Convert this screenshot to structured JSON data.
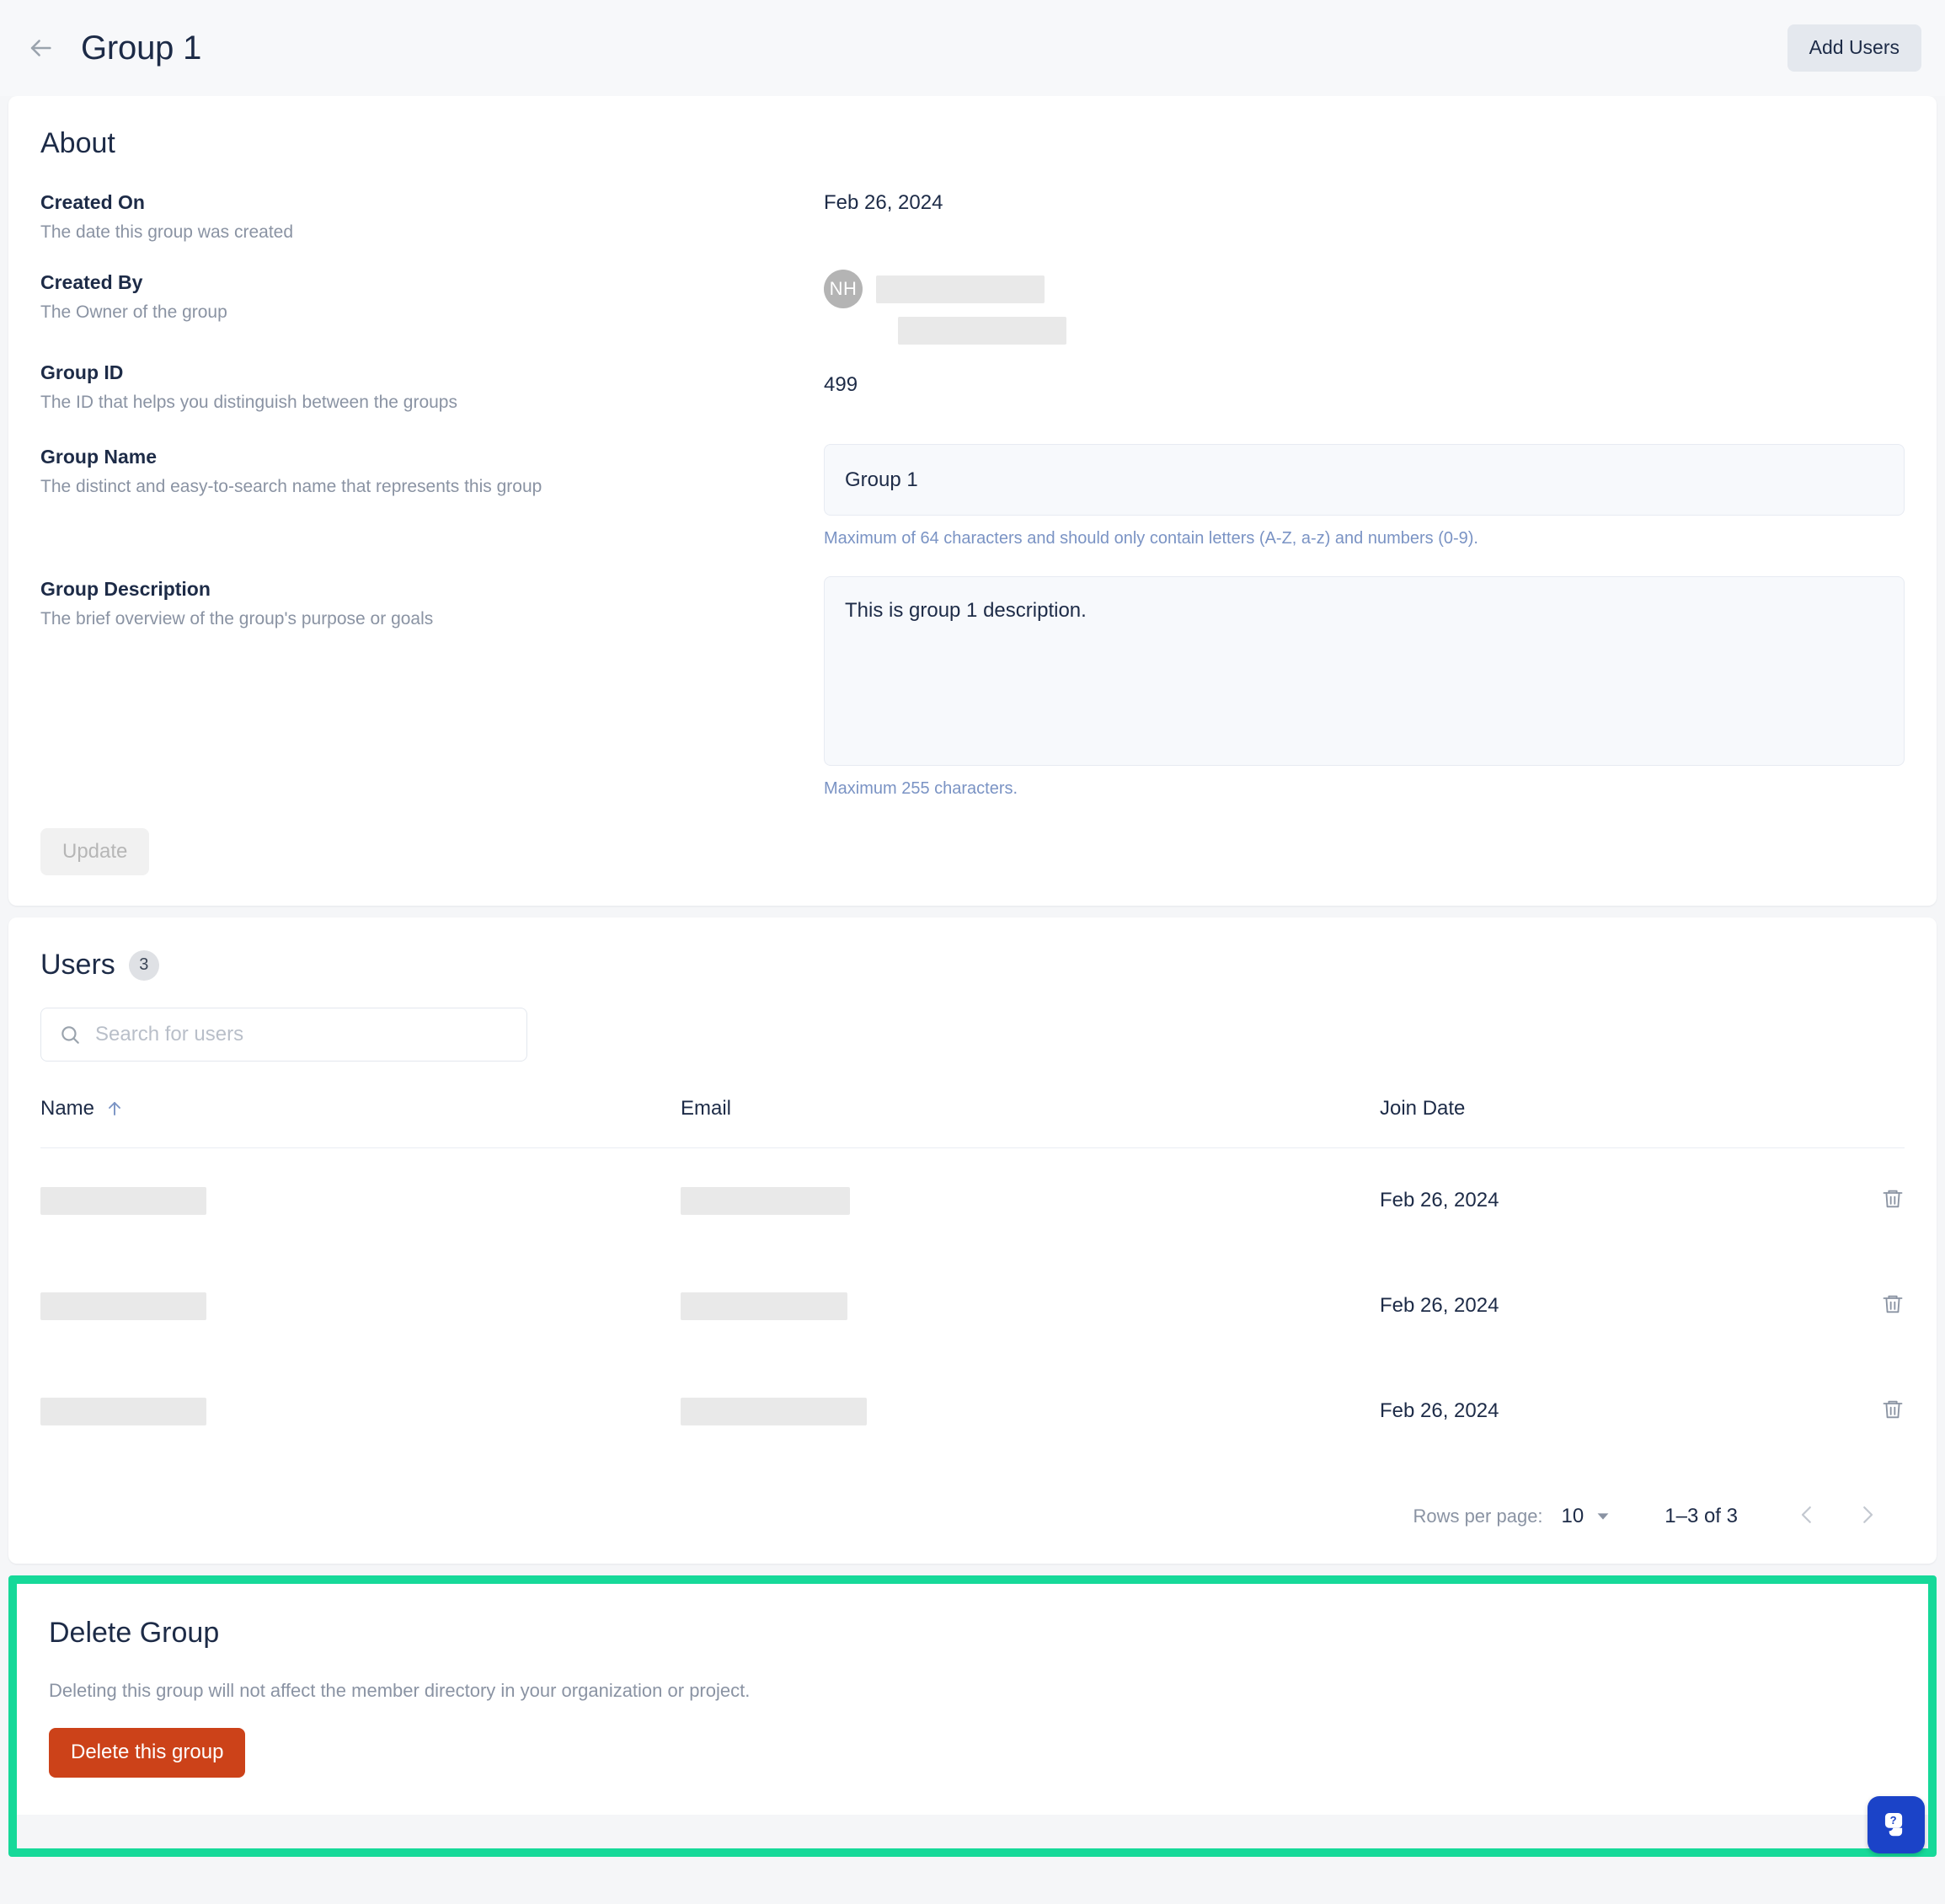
{
  "header": {
    "back_icon": "arrow-left-icon",
    "title": "Group 1",
    "add_users_label": "Add Users"
  },
  "about": {
    "section_title": "About",
    "fields": [
      {
        "label": "Created On",
        "description": "The date this group was created",
        "value": "Feb 26, 2024"
      },
      {
        "label": "Created By",
        "description": "The Owner of the group",
        "avatar_initials": "NH",
        "value_redacted": true
      },
      {
        "label": "Group ID",
        "description": "The ID that helps you distinguish between the groups",
        "value": "499"
      },
      {
        "label": "Group Name",
        "description": "The distinct and easy-to-search name that represents this group",
        "value": "Group 1",
        "helper": "Maximum of 64 characters and should only contain letters (A-Z, a-z) and numbers (0-9)."
      },
      {
        "label": "Group Description",
        "description": "The brief overview of the group's purpose or goals",
        "value": "This is group 1 description.",
        "helper": "Maximum 255 characters."
      }
    ],
    "update_label": "Update"
  },
  "users": {
    "section_title": "Users",
    "count": "3",
    "search_placeholder": "Search for users",
    "search_value": "",
    "search_icon": "search-icon",
    "columns": {
      "name": "Name",
      "email": "Email",
      "join_date": "Join Date"
    },
    "sort": {
      "column": "Name",
      "direction": "asc",
      "icon": "arrow-up-icon"
    },
    "rows": [
      {
        "name": "",
        "email": "",
        "join_date": "Feb 26, 2024",
        "delete_icon": "trash-icon",
        "redacted": true
      },
      {
        "name": "",
        "email": "",
        "join_date": "Feb 26, 2024",
        "delete_icon": "trash-icon",
        "redacted": true
      },
      {
        "name": "",
        "email": "",
        "join_date": "Feb 26, 2024",
        "delete_icon": "trash-icon",
        "redacted": true
      }
    ],
    "pagination": {
      "rows_per_page_label": "Rows per page:",
      "rows_per_page_value": "10",
      "range_label": "1–3 of 3",
      "prev_icon": "chevron-left-icon",
      "next_icon": "chevron-right-icon",
      "caret_icon": "caret-down-icon"
    }
  },
  "delete_group": {
    "section_title": "Delete Group",
    "description": "Deleting this group will not affect the member directory in your organization or project.",
    "button_label": "Delete this group",
    "highlight_color": "#16d999",
    "button_color": "#cc4219"
  },
  "help_widget": {
    "icon": "help-chat-icon",
    "color": "#1b43c8"
  }
}
